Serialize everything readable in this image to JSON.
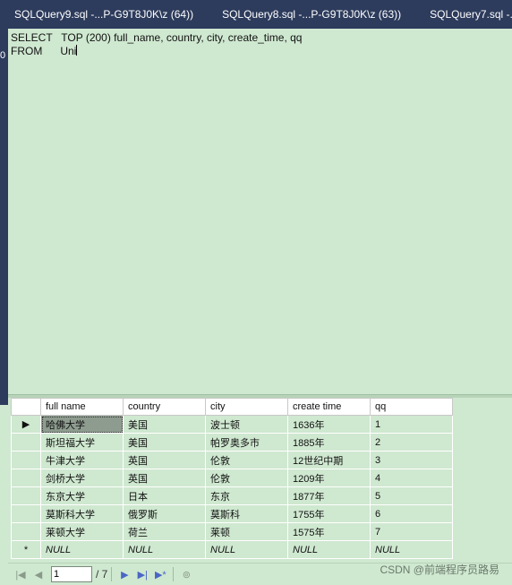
{
  "tabs": [
    {
      "label": "SQLQuery9.sql -...P-G9T8J0K\\z (64))"
    },
    {
      "label": "SQLQuery8.sql -...P-G9T8J0K\\z (63))"
    },
    {
      "label": "SQLQuery7.sql -...P-G9"
    }
  ],
  "left_strip_glyph": "0",
  "editor": {
    "lines": [
      "SELECT   TOP (200) full_name, country, city, create_time, qq",
      "FROM      Uni"
    ]
  },
  "grid": {
    "columns": [
      "full name",
      "country",
      "city",
      "create time",
      "qq"
    ],
    "rows": [
      {
        "marker": "▶",
        "cells": [
          "哈佛大学",
          "美国",
          "波士顿",
          "1636年",
          "1"
        ]
      },
      {
        "marker": "",
        "cells": [
          "斯坦福大学",
          "美国",
          "帕罗奥多市",
          "1885年",
          "2"
        ]
      },
      {
        "marker": "",
        "cells": [
          "牛津大学",
          "英国",
          "伦敦",
          "12世纪中期",
          "3"
        ]
      },
      {
        "marker": "",
        "cells": [
          "剑桥大学",
          "英国",
          "伦敦",
          "1209年",
          "4"
        ]
      },
      {
        "marker": "",
        "cells": [
          "东京大学",
          "日本",
          "东京",
          "1877年",
          "5"
        ]
      },
      {
        "marker": "",
        "cells": [
          "莫斯科大学",
          "俄罗斯",
          "莫斯科",
          "1755年",
          "6"
        ]
      },
      {
        "marker": "",
        "cells": [
          "莱顿大学",
          "荷兰",
          "莱顿",
          "1575年",
          "7"
        ]
      },
      {
        "marker": "*",
        "cells": [
          "NULL",
          "NULL",
          "NULL",
          "NULL",
          "NULL"
        ]
      }
    ]
  },
  "navigator": {
    "current": "1",
    "total": "/ 7"
  },
  "watermark": "CSDN @前端程序员路易"
}
